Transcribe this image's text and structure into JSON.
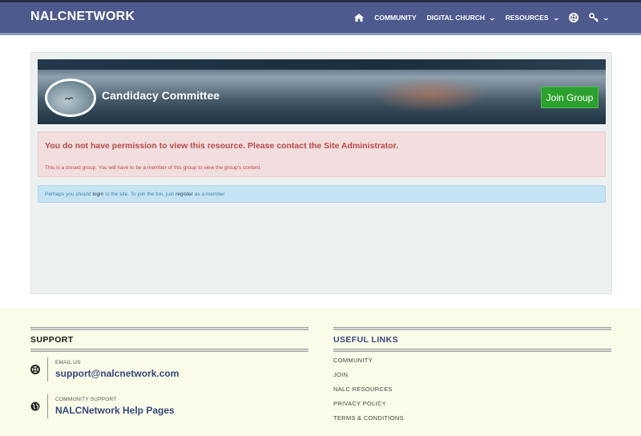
{
  "navbar": {
    "brand": "NALCNETWORK",
    "items": [
      {
        "label": "COMMUNITY",
        "dropdown": false
      },
      {
        "label": "DIGITAL CHURCH",
        "dropdown": true
      },
      {
        "label": "RESOURCES",
        "dropdown": true
      }
    ],
    "icons": [
      "home-icon",
      "lifebuoy-icon",
      "key-icon",
      "chevron-down-icon"
    ]
  },
  "group": {
    "title": "Candidacy Committee",
    "join_label": "Join Group"
  },
  "alert_danger": {
    "message": "You do not have permission to view this resource. Please contact the Site Administrator.",
    "detail": "This is a closed group. You will have to be a member of this group to view the group's content."
  },
  "alert_info": {
    "part1": "Perhaps you should",
    "login": "login",
    "part2": "to the site. To join the fun, just",
    "register": "register",
    "part3": "as a member"
  },
  "footer": {
    "support": {
      "heading": "SUPPORT",
      "email_label": "EMAIL US",
      "email_value": "support@nalcnetwork.com",
      "community_label": "COMMUNITY SUPPORT",
      "community_value": "NALCNetwork Help Pages"
    },
    "useful": {
      "heading": "USEFUL LINKS",
      "links": [
        "COMMUNITY",
        "JOIN",
        "NALC RESOURCES",
        "PRIVACY POLICY",
        "TERMS & CONDITIONS"
      ]
    }
  },
  "colors": {
    "navbar": "#4e5a8e",
    "join_button": "#2da12f",
    "danger_text": "#b94a48",
    "info_bg": "#c6e3f3",
    "footer_bg": "#fbfbea",
    "link_blue": "#35477a"
  }
}
